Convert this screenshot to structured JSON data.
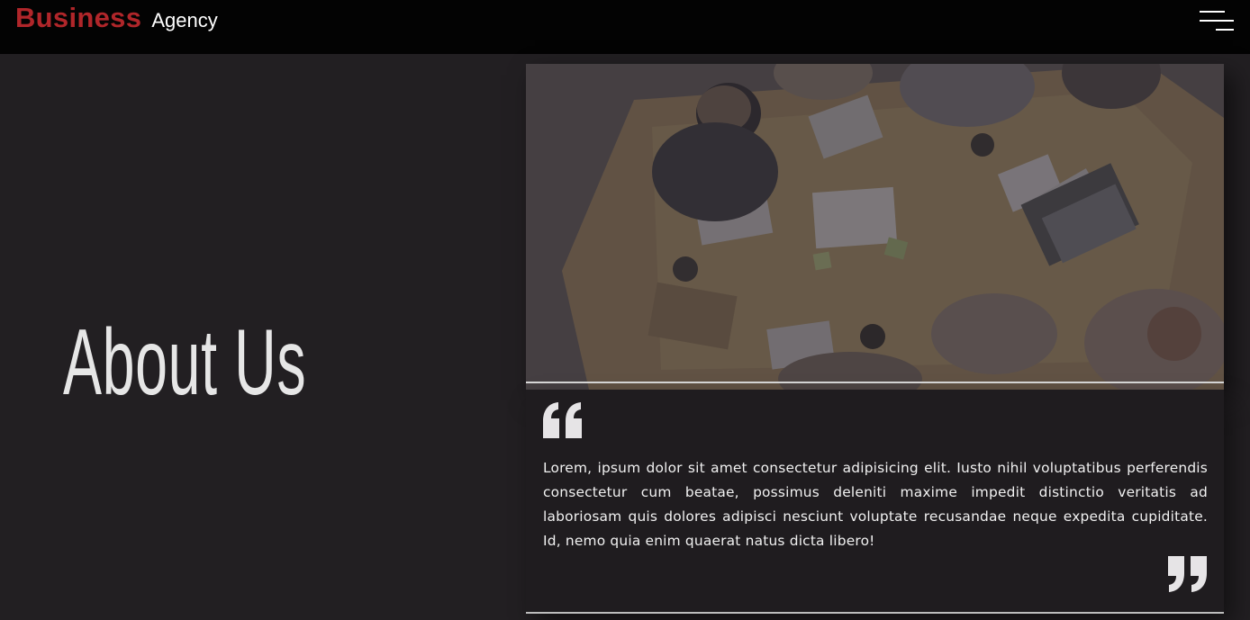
{
  "header": {
    "brand_main": "Business",
    "brand_sub": "Agency",
    "menu_icon": "hamburger-menu-icon"
  },
  "hero": {
    "title": "About Us"
  },
  "testimonial": {
    "image_alt": "Business meeting around a table",
    "open_quote_icon": "quote-open-icon",
    "close_quote_icon": "quote-close-icon",
    "text": "Lorem, ipsum dolor sit amet consectetur adipisicing elit. Iusto nihil voluptatibus perferendis consectetur cum beatae, possimus deleniti maxime impedit distinctio veritatis ad laboriosam quis dolores adipisci nesciunt voluptate recusandae neque expedita cupiditate. Id, nemo quia enim quaerat natus dicta libero!"
  },
  "colors": {
    "background": "#221f22",
    "topbar": "#030303",
    "brand_accent": "#b0262a",
    "text_light": "#e6e6e6"
  }
}
